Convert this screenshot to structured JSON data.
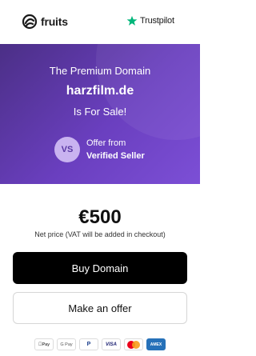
{
  "header": {
    "logo_text": "fruits",
    "trustpilot_label": "Trustpilot"
  },
  "hero": {
    "line1": "The Premium Domain",
    "domain": "harzfilm.de",
    "line3": "Is For Sale!",
    "badge": "VS",
    "offer_from": "Offer from",
    "seller": "Verified Seller"
  },
  "pricing": {
    "price": "€500",
    "note": "Net price (VAT will be added in checkout)"
  },
  "actions": {
    "buy_label": "Buy Domain",
    "offer_label": "Make an offer"
  },
  "payments": {
    "apple": "Pay",
    "google": "G Pay",
    "paypal": "P",
    "visa": "VISA",
    "amex": "AMEX"
  },
  "colors": {
    "hero_start": "#4b2f86",
    "hero_end": "#7c4fd6",
    "trustpilot_green": "#00b67a",
    "button_dark": "#000000"
  }
}
